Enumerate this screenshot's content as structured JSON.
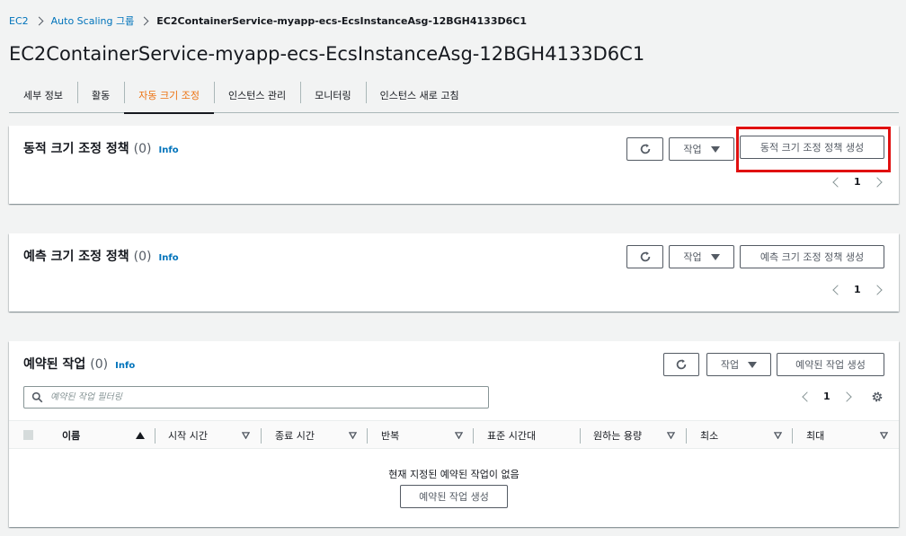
{
  "breadcrumb": {
    "items": [
      "EC2",
      "Auto Scaling 그룹"
    ],
    "current": "EC2ContainerService-myapp-ecs-EcsInstanceAsg-12BGH4133D6C1"
  },
  "page_title": "EC2ContainerService-myapp-ecs-EcsInstanceAsg-12BGH4133D6C1",
  "tabs": [
    {
      "label": "세부 정보",
      "active": false
    },
    {
      "label": "활동",
      "active": false
    },
    {
      "label": "자동 크기 조정",
      "active": true
    },
    {
      "label": "인스턴스 관리",
      "active": false
    },
    {
      "label": "모니터링",
      "active": false
    },
    {
      "label": "인스턴스 새로 고침",
      "active": false
    }
  ],
  "dynamic": {
    "title": "동적 크기 조정 정책",
    "count": "(0)",
    "info": "Info",
    "actions_label": "작업",
    "create_label": "동적 크기 조정 정책 생성",
    "page": "1"
  },
  "predictive": {
    "title": "예측 크기 조정 정책",
    "count": "(0)",
    "info": "Info",
    "actions_label": "작업",
    "create_label": "예측 크기 조정 정책 생성",
    "page": "1"
  },
  "scheduled": {
    "title": "예약된 작업",
    "count": "(0)",
    "info": "Info",
    "actions_label": "작업",
    "create_label": "예약된 작업 생성",
    "search_placeholder": "예약된 작업 필터링",
    "page": "1",
    "columns": [
      "이름",
      "시작 시간",
      "종료 시간",
      "반복",
      "표준 시간대",
      "원하는 용량",
      "최소",
      "최대"
    ],
    "empty_message": "현재 지정된 예약된 작업이 없음",
    "empty_create_label": "예약된 작업 생성"
  },
  "colors": {
    "accent": "#ec7211",
    "link": "#0073bb",
    "highlight": "#e01010"
  }
}
